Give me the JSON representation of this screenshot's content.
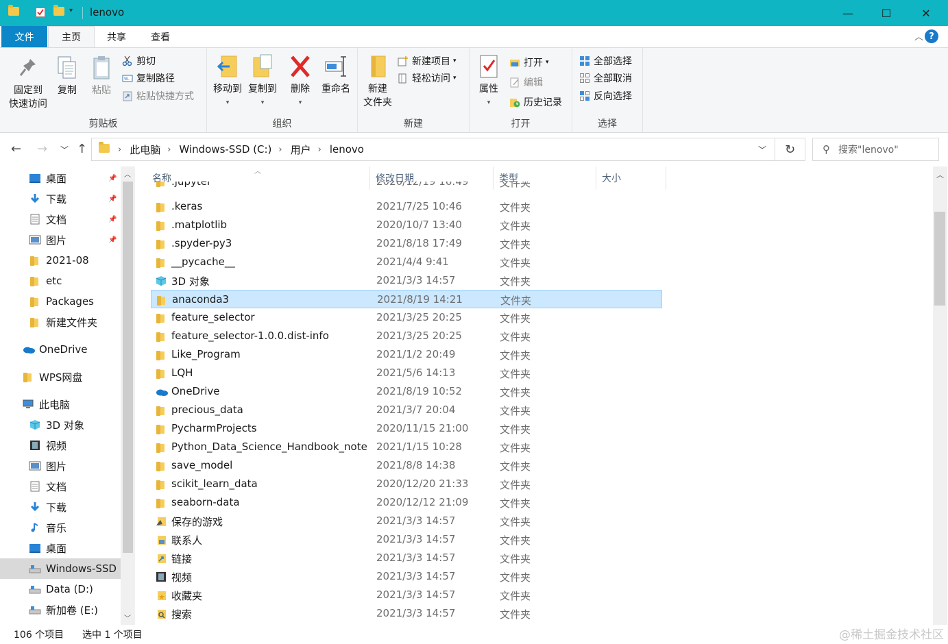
{
  "window": {
    "title": "lenovo",
    "minimize": "—",
    "maximize": "☐",
    "close": "✕"
  },
  "tabs": [
    {
      "label": "文件"
    },
    {
      "label": "主页"
    },
    {
      "label": "共享"
    },
    {
      "label": "查看"
    }
  ],
  "help_label": "?",
  "ribbon": {
    "clipboard": {
      "label": "剪贴板",
      "pin_line1": "固定到",
      "pin_line2": "快速访问",
      "copy": "复制",
      "paste": "粘贴",
      "cut": "剪切",
      "copy_path": "复制路径",
      "paste_shortcut": "粘贴快捷方式"
    },
    "organize": {
      "label": "组织",
      "move_to": "移动到",
      "copy_to": "复制到",
      "delete": "删除",
      "rename": "重命名"
    },
    "new": {
      "label": "新建",
      "new_folder_line1": "新建",
      "new_folder_line2": "文件夹",
      "new_item": "新建项目",
      "easy_access": "轻松访问"
    },
    "open": {
      "label": "打开",
      "properties": "属性",
      "open": "打开",
      "edit": "编辑",
      "history": "历史记录"
    },
    "select": {
      "label": "选择",
      "select_all": "全部选择",
      "select_none": "全部取消",
      "invert": "反向选择"
    }
  },
  "address": {
    "crumbs": [
      "此电脑",
      "Windows-SSD (C:)",
      "用户",
      "lenovo"
    ],
    "search_placeholder": "搜索\"lenovo\""
  },
  "nav": [
    {
      "label": "桌面",
      "icon": "desktop-icon",
      "pinned": true
    },
    {
      "label": "下载",
      "icon": "download-icon",
      "pinned": true
    },
    {
      "label": "文档",
      "icon": "document-icon",
      "pinned": true
    },
    {
      "label": "图片",
      "icon": "pictures-icon",
      "pinned": true
    },
    {
      "label": "2021-08",
      "icon": "folder-icon"
    },
    {
      "label": "etc",
      "icon": "folder-icon"
    },
    {
      "label": "Packages",
      "icon": "folder-icon"
    },
    {
      "label": "新建文件夹",
      "icon": "folder-icon"
    },
    {
      "label": "OneDrive",
      "icon": "cloud-icon"
    },
    {
      "label": "WPS网盘",
      "icon": "folder-icon"
    },
    {
      "label": "此电脑",
      "icon": "computer-icon"
    },
    {
      "label": "3D 对象",
      "icon": "cube-icon"
    },
    {
      "label": "视频",
      "icon": "video-icon"
    },
    {
      "label": "图片",
      "icon": "pictures-icon"
    },
    {
      "label": "文档",
      "icon": "document-icon"
    },
    {
      "label": "下载",
      "icon": "download-icon"
    },
    {
      "label": "音乐",
      "icon": "music-icon"
    },
    {
      "label": "桌面",
      "icon": "desktop-icon"
    },
    {
      "label": "Windows-SSD (",
      "icon": "drive-icon",
      "selected": true
    },
    {
      "label": "Data (D:)",
      "icon": "drive-icon"
    },
    {
      "label": "新加卷 (E:)",
      "icon": "drive-icon"
    }
  ],
  "columns": {
    "name": "名称",
    "date": "修改日期",
    "type": "类型",
    "size": "大小"
  },
  "files": [
    {
      "name": ".jupyter",
      "date": "2020/12/19 16:49",
      "type": "文件夹",
      "icon": "folder-icon"
    },
    {
      "name": ".keras",
      "date": "2021/7/25 10:46",
      "type": "文件夹",
      "icon": "folder-icon"
    },
    {
      "name": ".matplotlib",
      "date": "2020/10/7 13:40",
      "type": "文件夹",
      "icon": "folder-icon"
    },
    {
      "name": ".spyder-py3",
      "date": "2021/8/18 17:49",
      "type": "文件夹",
      "icon": "folder-icon"
    },
    {
      "name": "__pycache__",
      "date": "2021/4/4 9:41",
      "type": "文件夹",
      "icon": "folder-icon"
    },
    {
      "name": "3D 对象",
      "date": "2021/3/3 14:57",
      "type": "文件夹",
      "icon": "cube-icon"
    },
    {
      "name": "anaconda3",
      "date": "2021/8/19 14:21",
      "type": "文件夹",
      "icon": "folder-icon",
      "selected": true
    },
    {
      "name": "feature_selector",
      "date": "2021/3/25 20:25",
      "type": "文件夹",
      "icon": "folder-icon"
    },
    {
      "name": "feature_selector-1.0.0.dist-info",
      "date": "2021/3/25 20:25",
      "type": "文件夹",
      "icon": "folder-icon"
    },
    {
      "name": "Like_Program",
      "date": "2021/1/2 20:49",
      "type": "文件夹",
      "icon": "folder-icon"
    },
    {
      "name": "LQH",
      "date": "2021/5/6 14:13",
      "type": "文件夹",
      "icon": "folder-icon"
    },
    {
      "name": "OneDrive",
      "date": "2021/8/19 10:52",
      "type": "文件夹",
      "icon": "cloud-icon"
    },
    {
      "name": "precious_data",
      "date": "2021/3/7 20:04",
      "type": "文件夹",
      "icon": "folder-icon"
    },
    {
      "name": "PycharmProjects",
      "date": "2020/11/15 21:00",
      "type": "文件夹",
      "icon": "folder-icon"
    },
    {
      "name": "Python_Data_Science_Handbook_note",
      "date": "2021/1/15 10:28",
      "type": "文件夹",
      "icon": "folder-icon"
    },
    {
      "name": "save_model",
      "date": "2021/8/8 14:38",
      "type": "文件夹",
      "icon": "folder-icon"
    },
    {
      "name": "scikit_learn_data",
      "date": "2020/12/20 21:33",
      "type": "文件夹",
      "icon": "folder-icon"
    },
    {
      "name": "seaborn-data",
      "date": "2020/12/12 21:09",
      "type": "文件夹",
      "icon": "folder-icon"
    },
    {
      "name": "保存的游戏",
      "date": "2021/3/3 14:57",
      "type": "文件夹",
      "icon": "saved-games-icon"
    },
    {
      "name": "联系人",
      "date": "2021/3/3 14:57",
      "type": "文件夹",
      "icon": "contacts-icon"
    },
    {
      "name": "链接",
      "date": "2021/3/3 14:57",
      "type": "文件夹",
      "icon": "links-icon"
    },
    {
      "name": "视频",
      "date": "2021/3/3 14:57",
      "type": "文件夹",
      "icon": "video-icon"
    },
    {
      "name": "收藏夹",
      "date": "2021/3/3 14:57",
      "type": "文件夹",
      "icon": "favorites-icon"
    },
    {
      "name": "搜索",
      "date": "2021/3/3 14:57",
      "type": "文件夹",
      "icon": "search-folder-icon"
    }
  ],
  "status": {
    "count": "106 个项目",
    "selected": "选中 1 个项目"
  },
  "watermark": "@稀土掘金技术社区",
  "colors": {
    "titlebar": "#0fb5c2",
    "file_tab": "#0a86c9",
    "selection": "#cce8ff",
    "folder": "#f6cd5b"
  }
}
